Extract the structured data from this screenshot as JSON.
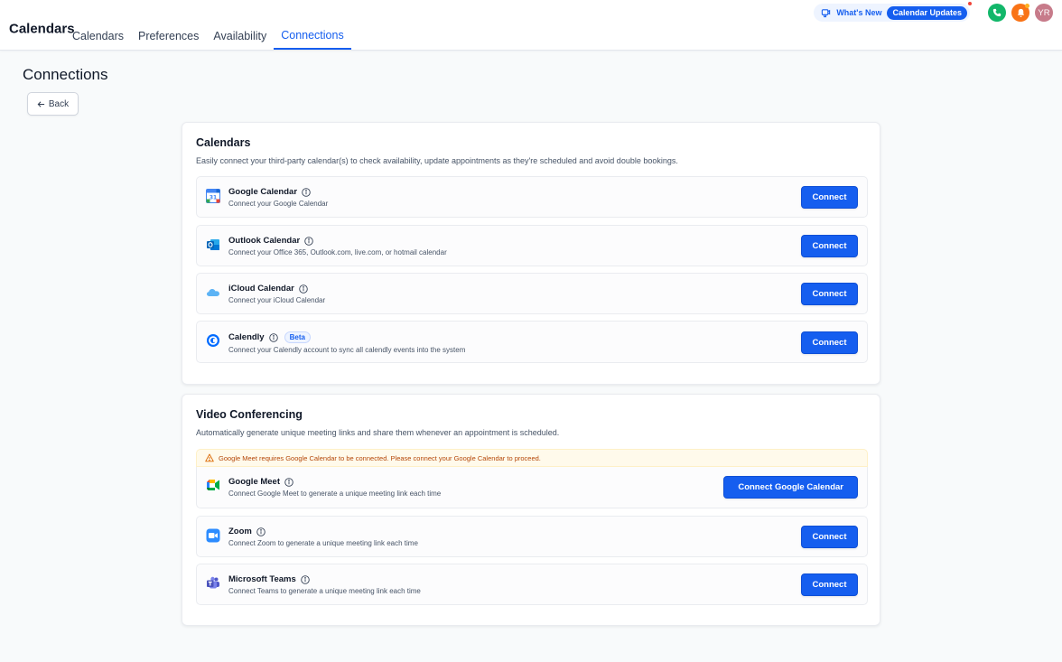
{
  "header": {
    "brand": "Calendars",
    "tabs": [
      {
        "label": "Calendars"
      },
      {
        "label": "Preferences"
      },
      {
        "label": "Availability"
      },
      {
        "label": "Connections"
      }
    ],
    "active_tab": "Connections",
    "whats_new_label": "What's New",
    "calendar_updates_label": "Calendar Updates",
    "avatar_initials": "YR"
  },
  "page": {
    "title": "Connections",
    "back_label": "Back"
  },
  "calendars": {
    "title": "Calendars",
    "description": "Easily connect your third-party calendar(s) to check availability, update appointments as they're scheduled and avoid double bookings.",
    "items": [
      {
        "name": "Google Calendar",
        "sub": "Connect your Google Calendar",
        "button": "Connect",
        "icon": "google-calendar-icon"
      },
      {
        "name": "Outlook Calendar",
        "sub": "Connect your Office 365, Outlook.com, live.com, or hotmail calendar",
        "button": "Connect",
        "icon": "outlook-icon"
      },
      {
        "name": "iCloud Calendar",
        "sub": "Connect your iCloud Calendar",
        "button": "Connect",
        "icon": "icloud-icon"
      },
      {
        "name": "Calendly",
        "badge": "Beta",
        "sub": "Connect your Calendly account to sync all calendly events into the system",
        "button": "Connect",
        "icon": "calendly-icon"
      }
    ]
  },
  "video": {
    "title": "Video Conferencing",
    "description": "Automatically generate unique meeting links and share them whenever an appointment is scheduled.",
    "warning": "Google Meet requires Google Calendar to be connected. Please connect your Google Calendar to proceed.",
    "items": [
      {
        "name": "Google Meet",
        "sub": "Connect Google Meet to generate a unique meeting link each time",
        "button": "Connect Google Calendar",
        "icon": "google-meet-icon"
      },
      {
        "name": "Zoom",
        "sub": "Connect Zoom to generate a unique meeting link each time",
        "button": "Connect",
        "icon": "zoom-icon"
      },
      {
        "name": "Microsoft Teams",
        "sub": "Connect Teams to generate a unique meeting link each time",
        "button": "Connect",
        "icon": "teams-icon"
      }
    ]
  },
  "colors": {
    "primary": "#155eef",
    "warning_bg": "#fffaeb",
    "warning_text": "#b54708",
    "phone": "#12b76a",
    "bell": "#f97316"
  }
}
